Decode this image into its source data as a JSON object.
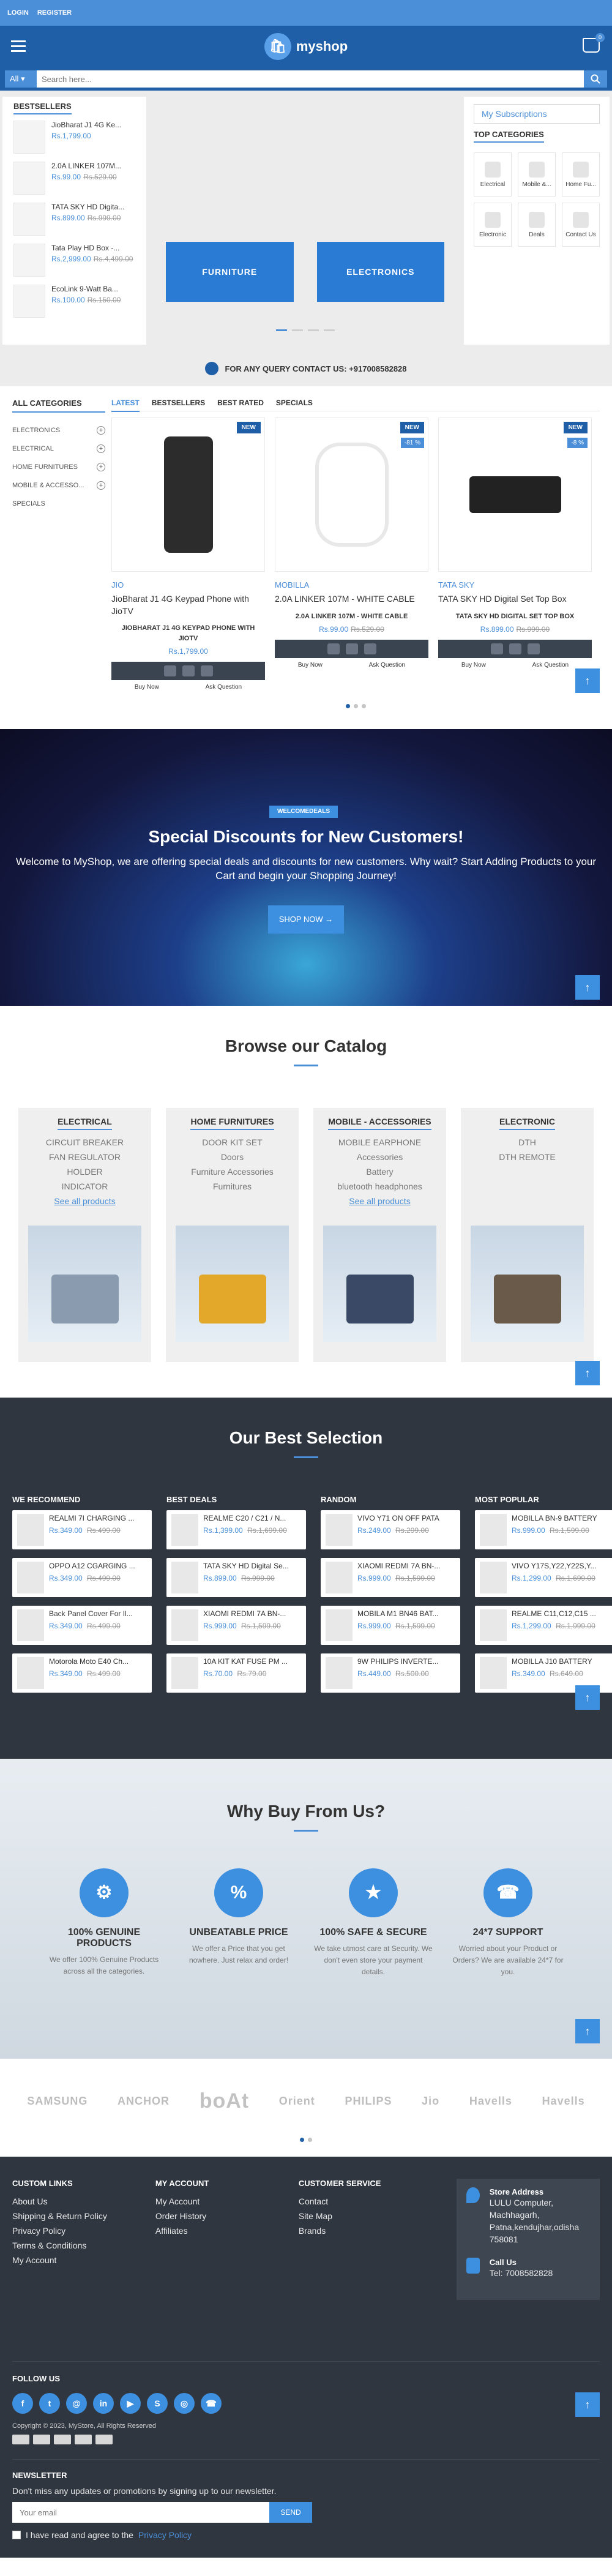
{
  "topbar": {
    "login": "LOGIN",
    "register": "REGISTER"
  },
  "header": {
    "logo": "myshop",
    "cart_count": "0"
  },
  "search": {
    "category": "All",
    "placeholder": "Search here..."
  },
  "bestsellers": {
    "title": "BESTSELLERS",
    "items": [
      {
        "name": "JioBharat J1 4G Ke...",
        "price": "Rs.1,799.00",
        "old": ""
      },
      {
        "name": "2.0A LINKER 107M...",
        "price": "Rs.99.00",
        "old": "Rs.529.00"
      },
      {
        "name": "TATA SKY HD Digita...",
        "price": "Rs.899.00",
        "old": "Rs.999.00"
      },
      {
        "name": "Tata Play HD Box -...",
        "price": "Rs.2,999.00",
        "old": "Rs.4,499.00"
      },
      {
        "name": "EcoLink 9-Watt Ba...",
        "price": "Rs.100.00",
        "old": "Rs.150.00"
      }
    ]
  },
  "slider": {
    "card1": "FURNITURE",
    "card2": "ELECTRONICS"
  },
  "right_panel": {
    "subscriptions": "My Subscriptions",
    "top_categories_title": "TOP CATEGORIES",
    "categories": [
      "Electrical",
      "Mobile &...",
      "Home Fu...",
      "Electronic",
      "Deals",
      "Contact Us"
    ]
  },
  "contact_bar": {
    "text": "FOR ANY QUERY CONTACT US: +917008582828"
  },
  "all_categories": {
    "title": "ALL CATEGORIES",
    "items": [
      "ELECTRONICS",
      "ELECTRICAL",
      "HOME FURNITURES",
      "MOBILE & ACCESSO...",
      "SPECIALS"
    ]
  },
  "tabs": [
    "LATEST",
    "BESTSELLERS",
    "BEST RATED",
    "SPECIALS"
  ],
  "products": [
    {
      "badge": "NEW",
      "discount": "",
      "brand": "JIO",
      "name": "JioBharat J1 4G Keypad Phone with JioTV",
      "name2": "JIOBHARAT J1 4G KEYPAD PHONE WITH JIOTV",
      "price": "Rs.1,799.00",
      "old": ""
    },
    {
      "badge": "NEW",
      "discount": "-81 %",
      "brand": "MOBILLA",
      "name": "2.0A LINKER 107M - WHITE CABLE",
      "name2": "2.0A LINKER 107M - WHITE CABLE",
      "price": "Rs.99.00",
      "old": "Rs.529.00"
    },
    {
      "badge": "NEW",
      "discount": "-8 %",
      "brand": "TATA SKY",
      "name": "TATA SKY HD Digital Set Top Box",
      "name2": "TATA SKY HD DIGITAL SET TOP BOX",
      "price": "Rs.899.00",
      "old": "Rs.999.00"
    }
  ],
  "product_actions": {
    "buy": "Buy Now",
    "ask": "Ask Question"
  },
  "promo": {
    "badge": "WELCOMEDEALS",
    "title": "Special Discounts for New Customers!",
    "text": "Welcome to MyShop, we are offering special deals and discounts for new customers. Why wait? Start Adding Products to your Cart and begin your Shopping Journey!",
    "button": "SHOP NOW"
  },
  "catalog": {
    "title": "Browse our Catalog",
    "cards": [
      {
        "title": "ELECTRICAL",
        "items": [
          "CIRCUIT BREAKER",
          "FAN REGULATOR",
          "HOLDER",
          "INDICATOR"
        ],
        "link": "See all products"
      },
      {
        "title": "HOME FURNITURES",
        "items": [
          "DOOR KIT SET",
          "Doors",
          "Furniture Accessories",
          "Furnitures"
        ],
        "link": ""
      },
      {
        "title": "MOBILE - ACCESSORIES",
        "items": [
          "MOBILE EARPHONE",
          "Accessories",
          "Battery",
          "bluetooth headphones"
        ],
        "link": "See all products"
      },
      {
        "title": "ELECTRONIC",
        "items": [
          "DTH",
          "DTH REMOTE"
        ],
        "link": ""
      }
    ]
  },
  "best_selection": {
    "title": "Our Best Selection",
    "columns": [
      {
        "title": "WE RECOMMEND",
        "items": [
          {
            "name": "REALMI 7I CHARGING ...",
            "price": "Rs.349.00",
            "old": "Rs.499.00"
          },
          {
            "name": "OPPO A12 CGARGING ...",
            "price": "Rs.349.00",
            "old": "Rs.499.00"
          },
          {
            "name": "Back Panel Cover For Il...",
            "price": "Rs.349.00",
            "old": "Rs.499.00"
          },
          {
            "name": "Motorola Moto E40 Ch...",
            "price": "Rs.349.00",
            "old": "Rs.499.00"
          }
        ]
      },
      {
        "title": "BEST DEALS",
        "items": [
          {
            "name": "REALME C20 / C21 / N...",
            "price": "Rs.1,399.00",
            "old": "Rs.1,699.00"
          },
          {
            "name": "TATA SKY HD Digital Se...",
            "price": "Rs.899.00",
            "old": "Rs.999.00"
          },
          {
            "name": "XIAOMI REDMI 7A BN-...",
            "price": "Rs.999.00",
            "old": "Rs.1,599.00"
          },
          {
            "name": "10A KIT KAT FUSE PM ...",
            "price": "Rs.70.00",
            "old": "Rs.79.00"
          }
        ]
      },
      {
        "title": "RANDOM",
        "items": [
          {
            "name": "VIVO Y71 ON OFF PATA",
            "price": "Rs.249.00",
            "old": "Rs.299.00"
          },
          {
            "name": "XIAOMI REDMI 7A BN-...",
            "price": "Rs.999.00",
            "old": "Rs.1,599.00"
          },
          {
            "name": "MOBILA M1 BN46 BAT...",
            "price": "Rs.999.00",
            "old": "Rs.1,599.00"
          },
          {
            "name": "9W PHILIPS INVERTE...",
            "price": "Rs.449.00",
            "old": "Rs.500.00"
          }
        ]
      },
      {
        "title": "MOST POPULAR",
        "items": [
          {
            "name": "MOBILLA BN-9 BATTERY",
            "price": "Rs.999.00",
            "old": "Rs.1,599.00"
          },
          {
            "name": "VIVO Y17S,Y22,Y22S,Y...",
            "price": "Rs.1,299.00",
            "old": "Rs.1,699.00"
          },
          {
            "name": "REALME C11,C12,C15 ...",
            "price": "Rs.1,299.00",
            "old": "Rs.1,999.00"
          },
          {
            "name": "MOBILLA J10 BATTERY",
            "price": "Rs.349.00",
            "old": "Rs.649.00"
          }
        ]
      }
    ]
  },
  "why": {
    "title": "Why Buy From Us?",
    "features": [
      {
        "title": "100% GENUINE PRODUCTS",
        "desc": "We offer 100% Genuine Products across all the categories."
      },
      {
        "title": "UNBEATABLE PRICE",
        "desc": "We offer a Price that you get nowhere. Just relax and order!"
      },
      {
        "title": "100% SAFE & SECURE",
        "desc": "We take utmost care at Security. We don't even store your payment details."
      },
      {
        "title": "24*7 SUPPORT",
        "desc": "Worried about your Product or Orders? We are available 24*7 for you."
      }
    ]
  },
  "brands": [
    "SAMSUNG",
    "ANCHOR",
    "boAt",
    "Orient",
    "PHILIPS",
    "Jio",
    "Havells",
    "Havells"
  ],
  "footer": {
    "custom_links": {
      "title": "CUSTOM LINKS",
      "items": [
        "About Us",
        "Shipping & Return Policy",
        "Privacy Policy",
        "Terms & Conditions",
        "My Account"
      ]
    },
    "my_account": {
      "title": "MY ACCOUNT",
      "items": [
        "My Account",
        "Order History",
        "Affiliates"
      ]
    },
    "customer_service": {
      "title": "CUSTOMER SERVICE",
      "items": [
        "Contact",
        "Site Map",
        "Brands"
      ]
    },
    "store": {
      "title": "Store Address",
      "address": "LULU Computer, Machhagarh, Patna,kendujhar,odisha 758081",
      "call_title": "Call Us",
      "phone": "Tel: 7008582828"
    },
    "follow": "FOLLOW US",
    "copyright": "Copyright © 2023, MyStore, All Rights Reserved",
    "newsletter_title": "NEWSLETTER",
    "newsletter_desc": "Don't miss any updates or promotions by signing up to our newsletter.",
    "email_placeholder": "Your email",
    "send": "SEND",
    "agree": "I have read and agree to the",
    "privacy": "Privacy Policy"
  }
}
